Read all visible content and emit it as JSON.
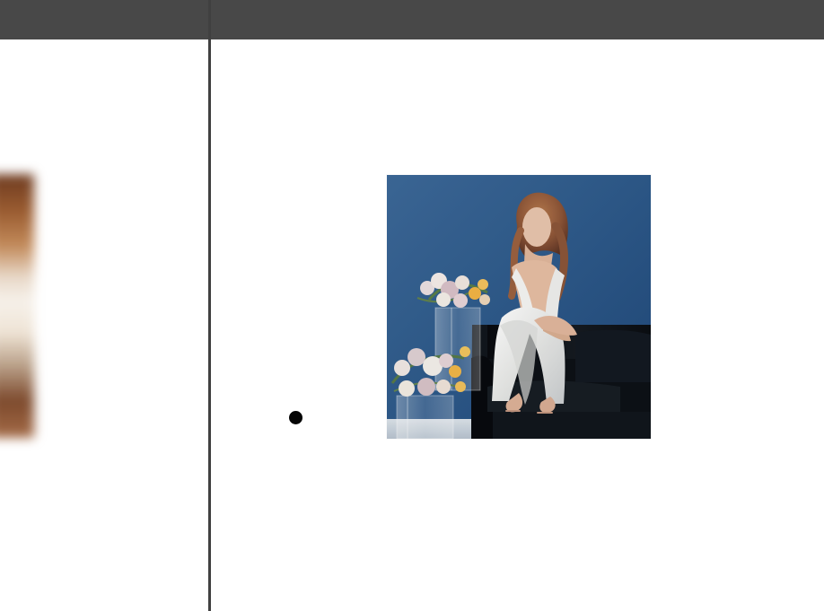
{
  "window": {
    "title": ""
  },
  "viewer": {
    "left_preview_icon": "blurred-photo-thumbnail",
    "main_image_icon": "photo-preview",
    "indicator_icon": "dot-indicator"
  },
  "colors": {
    "topbar": "#484848",
    "divider": "#404040",
    "background": "#ffffff",
    "dot": "#050505",
    "photo_blue": "#2b5786",
    "sofa_black": "#101419",
    "dress_white": "#f1f1ef"
  }
}
